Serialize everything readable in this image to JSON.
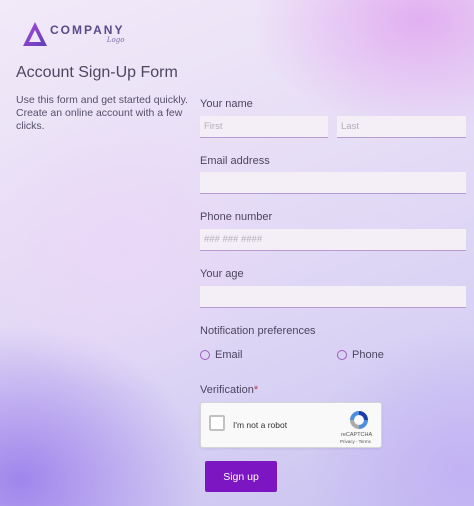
{
  "logo": {
    "company": "COMPANY",
    "sub": "Logo"
  },
  "form": {
    "title": "Account Sign-Up Form",
    "intro": "Use this form and get started quickly. Create an online account with a few clicks.",
    "name": {
      "label": "Your name",
      "first_placeholder": "First",
      "last_placeholder": "Last"
    },
    "email": {
      "label": "Email address",
      "value": ""
    },
    "phone": {
      "label": "Phone number",
      "placeholder": "### ### ####"
    },
    "age": {
      "label": "Your age",
      "value": ""
    },
    "notifications": {
      "label": "Notification preferences",
      "options": [
        "Email",
        "Phone"
      ]
    },
    "verification": {
      "label": "Verification",
      "required_mark": "*"
    },
    "captcha": {
      "checkbox_label": "I'm not a robot",
      "brand": "reCAPTCHA",
      "links": "Privacy - Terms"
    },
    "submit_label": "Sign up"
  },
  "colors": {
    "accent": "#7b16c2",
    "radio": "#a05bc0",
    "input_bg": "#f4eff6"
  }
}
